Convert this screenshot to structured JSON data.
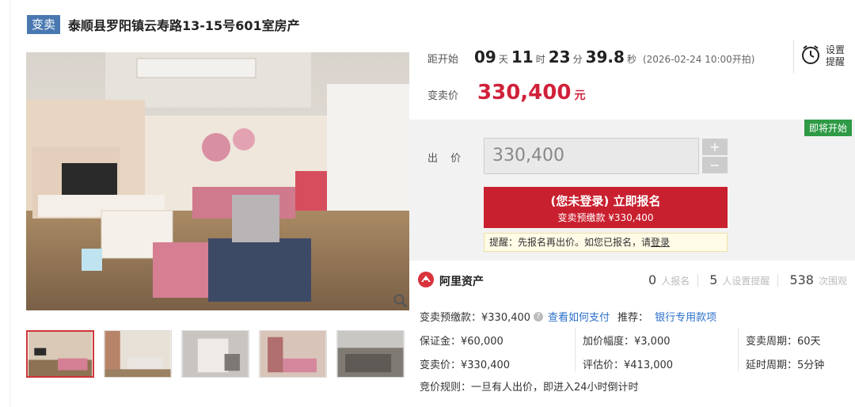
{
  "header": {
    "badge": "变卖",
    "title": "泰顺县罗阳镇云寿路13-15号601室房产"
  },
  "countdown": {
    "label": "距开始",
    "days": "09",
    "days_unit": "天",
    "hours": "11",
    "hours_unit": "时",
    "minutes": "23",
    "minutes_unit": "分",
    "seconds": "39.8",
    "seconds_unit": "秒",
    "start_note": "(2026-02-24 10:00开拍)"
  },
  "reminder": {
    "line1": "设置",
    "line2": "提醒",
    "icon": "alarm-clock-icon"
  },
  "price": {
    "label": "变卖价",
    "value": "330,400",
    "unit": "元"
  },
  "bid": {
    "status_badge": "即将开始",
    "label": "出 价",
    "input_value": "330,400",
    "plus": "+",
    "minus": "−",
    "signup_main": "(您未登录) 立即报名",
    "signup_sub": "变卖预缴款 ¥330,400",
    "tip_text": "提醒：先报名再出价。如您已报名，请",
    "tip_link": "登录"
  },
  "platform": {
    "name": "阿里资产",
    "signups_num": "0",
    "signups_label": "人报名",
    "reminders_num": "5",
    "reminders_label": "人设置提醒",
    "views_num": "538",
    "views_label": "次围观"
  },
  "deposit": {
    "text": "变卖预缴款：¥330,400",
    "help": "?",
    "how_to_pay": "查看如何支付",
    "recommend_label": "推荐：",
    "recommend_link": "银行专用款项"
  },
  "info": {
    "security": "保证金：¥60,000",
    "increment": "加价幅度：¥3,000",
    "period": "变卖周期：60天",
    "sale_price": "变卖价：¥330,400",
    "appraisal": "评估价：¥413,000",
    "delay": "延时周期：5分钟",
    "rule": "竞价规则：一旦有人出价，即进入24小时倒计时"
  },
  "colors": {
    "accent_red": "#c9202f",
    "price_red": "#d0213a",
    "badge_blue": "#4a79b2",
    "badge_green": "#2e9a45",
    "link_blue": "#2a6fc9"
  }
}
